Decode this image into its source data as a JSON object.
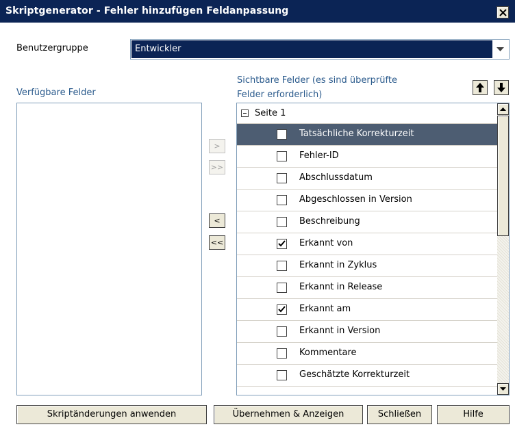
{
  "window": {
    "title": "Skriptgenerator - Fehler hinzufügen Feldanpassung"
  },
  "user_group": {
    "label": "Benutzergruppe",
    "value": "Entwickler"
  },
  "available": {
    "label": "Verfügbare Felder",
    "items": []
  },
  "visible": {
    "label_line1": "Sichtbare Felder (es sind überprüfte",
    "label_line2": "Felder erforderlich)",
    "root": "Seite 1",
    "items": [
      {
        "label": "Tatsächliche Korrekturzeit",
        "checked": false,
        "selected": true
      },
      {
        "label": "Fehler-ID",
        "checked": false,
        "selected": false
      },
      {
        "label": "Abschlussdatum",
        "checked": false,
        "selected": false
      },
      {
        "label": "Abgeschlossen in Version",
        "checked": false,
        "selected": false
      },
      {
        "label": "Beschreibung",
        "checked": false,
        "selected": false
      },
      {
        "label": "Erkannt von",
        "checked": true,
        "selected": false
      },
      {
        "label": "Erkannt in Zyklus",
        "checked": false,
        "selected": false
      },
      {
        "label": "Erkannt in Release",
        "checked": false,
        "selected": false
      },
      {
        "label": "Erkannt am",
        "checked": true,
        "selected": false
      },
      {
        "label": "Erkannt in Version",
        "checked": false,
        "selected": false
      },
      {
        "label": "Kommentare",
        "checked": false,
        "selected": false
      },
      {
        "label": "Geschätzte Korrekturzeit",
        "checked": false,
        "selected": false
      }
    ]
  },
  "move_buttons": {
    "add": ">",
    "add_all": ">>",
    "remove": "<",
    "remove_all": "<<"
  },
  "buttons": {
    "apply": "Skriptänderungen anwenden",
    "accept_show": "Übernehmen & Anzeigen",
    "close": "Schließen",
    "help": "Hilfe"
  },
  "colors": {
    "title_bar": "#0b2455",
    "selection": "#4d5d72",
    "label_blue": "#2a5a8c"
  }
}
